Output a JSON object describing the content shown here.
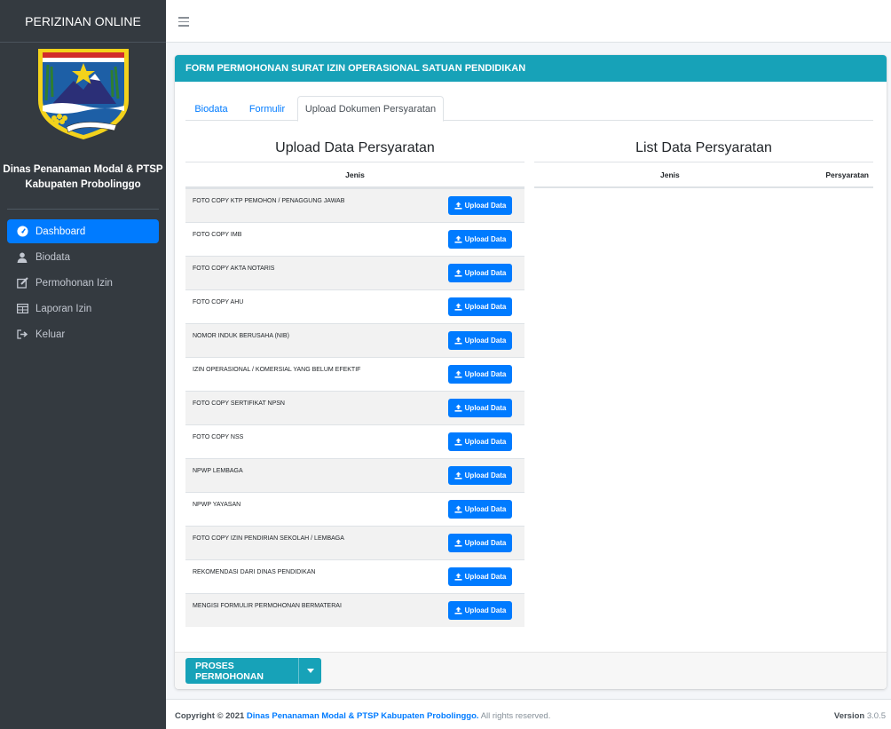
{
  "app": {
    "brand": "PERIZINAN ONLINE",
    "agency_line1": "Dinas Penanaman Modal & PTSP",
    "agency_line2": "Kabupaten Probolinggo"
  },
  "sidebar": {
    "items": [
      {
        "label": "Dashboard",
        "icon": "tachometer-icon",
        "active": true
      },
      {
        "label": "Biodata",
        "icon": "user-icon",
        "active": false
      },
      {
        "label": "Permohonan Izin",
        "icon": "edit-icon",
        "active": false
      },
      {
        "label": "Laporan Izin",
        "icon": "table-icon",
        "active": false
      },
      {
        "label": "Keluar",
        "icon": "sign-out-icon",
        "active": false
      }
    ]
  },
  "card": {
    "title": "FORM PERMOHONAN SURAT IZIN OPERASIONAL SATUAN PENDIDIKAN"
  },
  "tabs": [
    {
      "label": "Biodata",
      "active": false
    },
    {
      "label": "Formulir",
      "active": false
    },
    {
      "label": "Upload Dokumen Persyaratan",
      "active": true
    }
  ],
  "upload_section": {
    "title": "Upload Data Persyaratan",
    "col_jenis": "Jenis",
    "button_label": "Upload Data",
    "rows": [
      "FOTO COPY KTP PEMOHON / PENAGGUNG JAWAB",
      "FOTO COPY IMB",
      "FOTO COPY AKTA NOTARIS",
      "FOTO COPY AHU",
      "NOMOR INDUK BERUSAHA (NIB)",
      "IZIN OPERASIONAL / KOMERSIAL YANG BELUM EFEKTIF",
      "FOTO COPY SERTIFIKAT NPSN",
      "FOTO COPY NSS",
      "NPWP LEMBAGA",
      "NPWP YAYASAN",
      "FOTO COPY IZIN PENDIRIAN SEKOLAH / LEMBAGA",
      "REKOMENDASI DARI DINAS PENDIDIKAN",
      "MENGISI FORMULIR PERMOHONAN BERMATERAI"
    ]
  },
  "list_section": {
    "title": "List Data Persyaratan",
    "col_jenis": "Jenis",
    "col_persyaratan": "Persyaratan"
  },
  "actions": {
    "proses_label": "PROSES PERMOHONAN"
  },
  "footer": {
    "copyright_prefix": "Copyright © 2021",
    "copyright_link": "Dinas Penanaman Modal & PTSP Kabupaten Probolinggo.",
    "copyright_suffix": "All rights reserved.",
    "version_label": "Version",
    "version_value": "3.0.5"
  },
  "colors": {
    "sidebar": "#343a40",
    "primary": "#007bff",
    "info": "#17a2b8",
    "background": "#f4f6f9"
  }
}
